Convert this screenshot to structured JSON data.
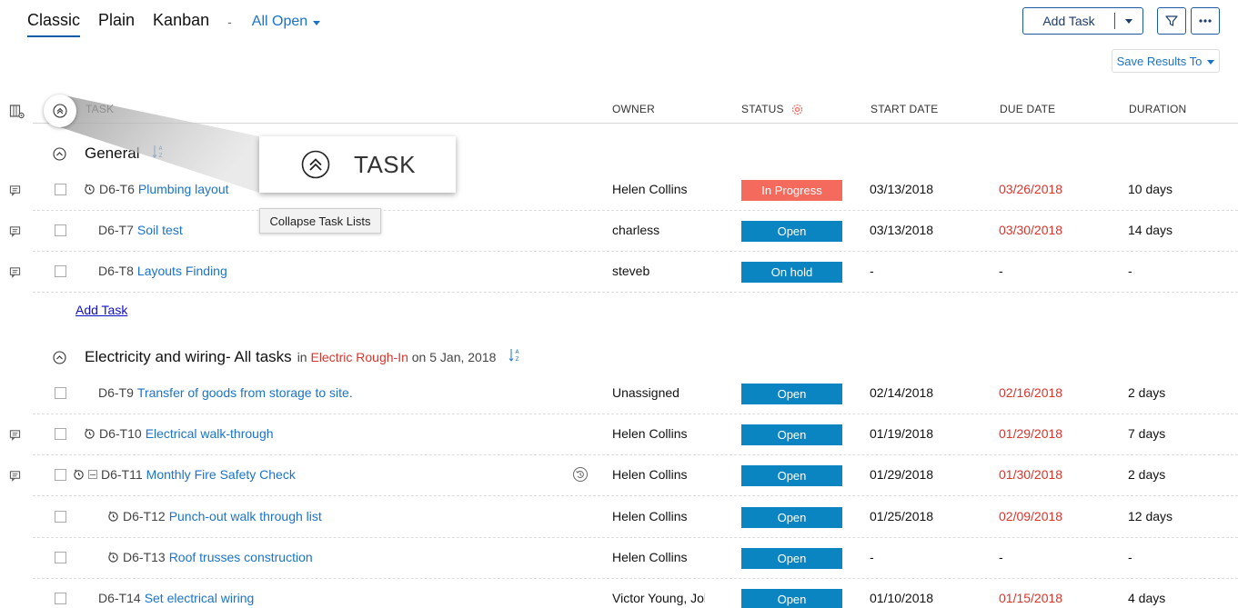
{
  "views": {
    "tabs": [
      {
        "label": "Classic",
        "active": true
      },
      {
        "label": "Plain",
        "active": false
      },
      {
        "label": "Kanban",
        "active": false
      }
    ],
    "separator": "-",
    "filter": "All Open"
  },
  "toolbar": {
    "add_task_label": "Add Task",
    "filter_icon": "filter-icon",
    "more_icon": "more-icon",
    "save_results_label": "Save Results To"
  },
  "columns": {
    "task": "TASK",
    "owner": "OWNER",
    "status": "STATUS",
    "start_date": "START DATE",
    "due_date": "DUE DATE",
    "duration": "DURATION"
  },
  "overlay": {
    "zoom_label": "TASK",
    "tooltip": "Collapse Task Lists"
  },
  "groups": [
    {
      "title": "General",
      "rows": [
        {
          "id": "D6-T6",
          "name": "Plumbing layout",
          "owner": "Helen Collins",
          "status": "In Progress",
          "start": "03/13/2018",
          "due": "03/26/2018",
          "duration": "10 days"
        },
        {
          "id": "D6-T7",
          "name": "Soil test",
          "owner": "charless",
          "status": "Open",
          "start": "03/13/2018",
          "due": "03/30/2018",
          "duration": "14 days"
        },
        {
          "id": "D6-T8",
          "name": "Layouts Finding",
          "owner": "steveb",
          "status": "On hold",
          "start": "-",
          "due": "-",
          "duration": "-"
        }
      ],
      "add_task": "Add Task"
    },
    {
      "title": "Electricity and wiring- All tasks",
      "in_word": "in",
      "milestone": "Electric Rough-In",
      "on_text": "on 5 Jan, 2018",
      "rows": [
        {
          "id": "D6-T9",
          "name": "Transfer of goods from storage to site.",
          "owner": "Unassigned",
          "status": "Open",
          "start": "02/14/2018",
          "due": "02/16/2018",
          "duration": "2 days"
        },
        {
          "id": "D6-T10",
          "name": "Electrical walk-through",
          "owner": "Helen Collins",
          "status": "Open",
          "start": "01/19/2018",
          "due": "01/29/2018",
          "duration": "7 days"
        },
        {
          "id": "D6-T11",
          "name": "Monthly Fire Safety Check",
          "owner": "Helen Collins",
          "status": "Open",
          "start": "01/29/2018",
          "due": "01/30/2018",
          "duration": "2 days"
        },
        {
          "id": "D6-T12",
          "name": "Punch-out walk through list",
          "owner": "Helen Collins",
          "status": "Open",
          "start": "01/25/2018",
          "due": "02/09/2018",
          "duration": "12 days"
        },
        {
          "id": "D6-T13",
          "name": "Roof trusses construction",
          "owner": "Helen Collins",
          "status": "Open",
          "start": "-",
          "due": "-",
          "duration": "-"
        },
        {
          "id": "D6-T14",
          "name": "Set electrical wiring",
          "owner": "Victor Young, John",
          "status": "Open",
          "start": "01/10/2018",
          "due": "01/15/2018",
          "duration": "4 days"
        }
      ]
    }
  ],
  "colors": {
    "in_progress": "#f46b5e",
    "open": "#0b85c1",
    "on_hold": "#0b85c1",
    "link": "#1a73c9",
    "overdue": "#d9342b"
  }
}
